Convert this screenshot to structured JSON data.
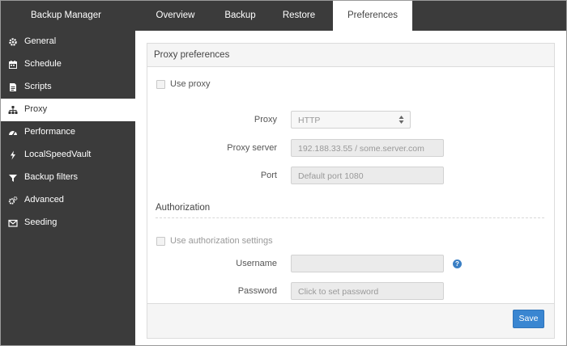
{
  "app": {
    "title": "Backup Manager"
  },
  "tabs": [
    {
      "label": "Overview"
    },
    {
      "label": "Backup"
    },
    {
      "label": "Restore"
    },
    {
      "label": "Preferences"
    }
  ],
  "sidebar": {
    "items": [
      {
        "label": "General",
        "icon": "gear-icon"
      },
      {
        "label": "Schedule",
        "icon": "calendar-icon"
      },
      {
        "label": "Scripts",
        "icon": "document-icon"
      },
      {
        "label": "Proxy",
        "icon": "network-icon"
      },
      {
        "label": "Performance",
        "icon": "gauge-icon"
      },
      {
        "label": "LocalSpeedVault",
        "icon": "lightning-icon"
      },
      {
        "label": "Backup filters",
        "icon": "filter-icon"
      },
      {
        "label": "Advanced",
        "icon": "cogs-icon"
      },
      {
        "label": "Seeding",
        "icon": "envelope-icon"
      }
    ]
  },
  "panel": {
    "title": "Proxy preferences",
    "use_proxy_label": "Use proxy",
    "proxy_label": "Proxy",
    "proxy_value": "HTTP",
    "proxy_server_label": "Proxy server",
    "proxy_server_placeholder": "192.188.33.55 / some.server.com",
    "port_label": "Port",
    "port_placeholder": "Default port 1080",
    "authorization_title": "Authorization",
    "use_auth_label": "Use authorization settings",
    "username_label": "Username",
    "username_value": "",
    "password_label": "Password",
    "password_placeholder": "Click to set password",
    "help_glyph": "?",
    "save_label": "Save"
  },
  "colors": {
    "sidebar_bg": "#3b3b3b",
    "accent": "#3a86d1"
  }
}
